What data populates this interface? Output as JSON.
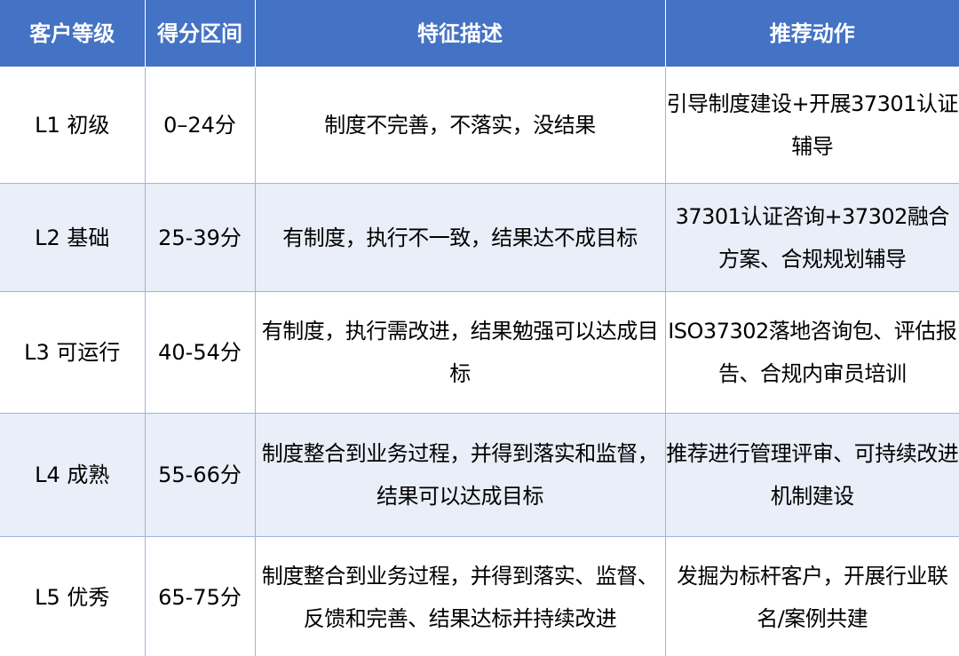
{
  "headers": [
    "客户等级",
    "得分区间",
    "特征描述",
    "推荐动作"
  ],
  "rows": [
    {
      "level": "L1 初级",
      "score": "0–24分",
      "feature": "制度不完善，不落实，没结果",
      "action": "引导制度建设+开展37301认证辅导"
    },
    {
      "level": "L2 基础",
      "score": "25-39分",
      "feature": "有制度，执行不一致，结果达不成目标",
      "action": "37301认证咨询+37302融合方案、合规规划辅导"
    },
    {
      "level": "L3 可运行",
      "score": "40-54分",
      "feature": "有制度，执行需改进，结果勉强可以达成目标",
      "action": "ISO37302落地咨询包、评估报告、合规内审员培训"
    },
    {
      "level": "L4 成熟",
      "score": "55-66分",
      "feature": "制度整合到业务过程，并得到落实和监督，结果可以达成目标",
      "action": "推荐进行管理评审、可持续改进机制建设"
    },
    {
      "level": "L5 优秀",
      "score": "65-75分",
      "feature": "制度整合到业务过程，并得到落实、监督、反馈和完善、结果达标并持续改进",
      "action": "发掘为标杆客户，开展行业联名/案例共建"
    }
  ]
}
